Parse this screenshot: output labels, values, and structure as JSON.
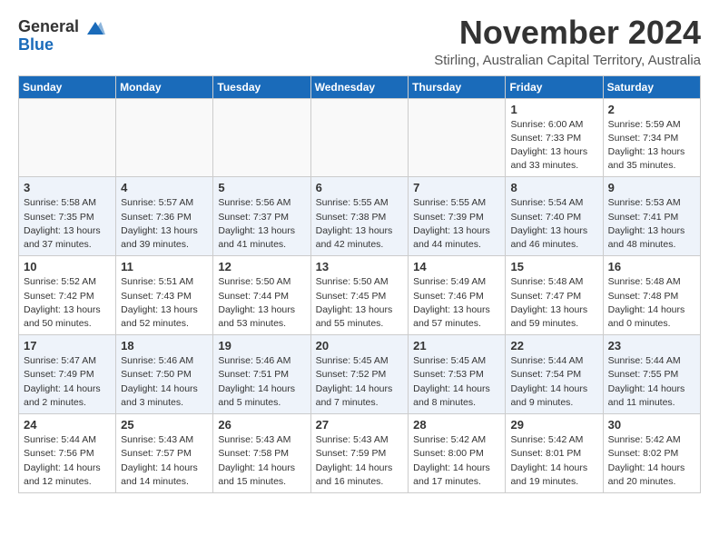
{
  "logo": {
    "general": "General",
    "blue": "Blue"
  },
  "title": "November 2024",
  "subtitle": "Stirling, Australian Capital Territory, Australia",
  "weekdays": [
    "Sunday",
    "Monday",
    "Tuesday",
    "Wednesday",
    "Thursday",
    "Friday",
    "Saturday"
  ],
  "weeks": [
    [
      {
        "day": "",
        "info": ""
      },
      {
        "day": "",
        "info": ""
      },
      {
        "day": "",
        "info": ""
      },
      {
        "day": "",
        "info": ""
      },
      {
        "day": "",
        "info": ""
      },
      {
        "day": "1",
        "info": "Sunrise: 6:00 AM\nSunset: 7:33 PM\nDaylight: 13 hours\nand 33 minutes."
      },
      {
        "day": "2",
        "info": "Sunrise: 5:59 AM\nSunset: 7:34 PM\nDaylight: 13 hours\nand 35 minutes."
      }
    ],
    [
      {
        "day": "3",
        "info": "Sunrise: 5:58 AM\nSunset: 7:35 PM\nDaylight: 13 hours\nand 37 minutes."
      },
      {
        "day": "4",
        "info": "Sunrise: 5:57 AM\nSunset: 7:36 PM\nDaylight: 13 hours\nand 39 minutes."
      },
      {
        "day": "5",
        "info": "Sunrise: 5:56 AM\nSunset: 7:37 PM\nDaylight: 13 hours\nand 41 minutes."
      },
      {
        "day": "6",
        "info": "Sunrise: 5:55 AM\nSunset: 7:38 PM\nDaylight: 13 hours\nand 42 minutes."
      },
      {
        "day": "7",
        "info": "Sunrise: 5:55 AM\nSunset: 7:39 PM\nDaylight: 13 hours\nand 44 minutes."
      },
      {
        "day": "8",
        "info": "Sunrise: 5:54 AM\nSunset: 7:40 PM\nDaylight: 13 hours\nand 46 minutes."
      },
      {
        "day": "9",
        "info": "Sunrise: 5:53 AM\nSunset: 7:41 PM\nDaylight: 13 hours\nand 48 minutes."
      }
    ],
    [
      {
        "day": "10",
        "info": "Sunrise: 5:52 AM\nSunset: 7:42 PM\nDaylight: 13 hours\nand 50 minutes."
      },
      {
        "day": "11",
        "info": "Sunrise: 5:51 AM\nSunset: 7:43 PM\nDaylight: 13 hours\nand 52 minutes."
      },
      {
        "day": "12",
        "info": "Sunrise: 5:50 AM\nSunset: 7:44 PM\nDaylight: 13 hours\nand 53 minutes."
      },
      {
        "day": "13",
        "info": "Sunrise: 5:50 AM\nSunset: 7:45 PM\nDaylight: 13 hours\nand 55 minutes."
      },
      {
        "day": "14",
        "info": "Sunrise: 5:49 AM\nSunset: 7:46 PM\nDaylight: 13 hours\nand 57 minutes."
      },
      {
        "day": "15",
        "info": "Sunrise: 5:48 AM\nSunset: 7:47 PM\nDaylight: 13 hours\nand 59 minutes."
      },
      {
        "day": "16",
        "info": "Sunrise: 5:48 AM\nSunset: 7:48 PM\nDaylight: 14 hours\nand 0 minutes."
      }
    ],
    [
      {
        "day": "17",
        "info": "Sunrise: 5:47 AM\nSunset: 7:49 PM\nDaylight: 14 hours\nand 2 minutes."
      },
      {
        "day": "18",
        "info": "Sunrise: 5:46 AM\nSunset: 7:50 PM\nDaylight: 14 hours\nand 3 minutes."
      },
      {
        "day": "19",
        "info": "Sunrise: 5:46 AM\nSunset: 7:51 PM\nDaylight: 14 hours\nand 5 minutes."
      },
      {
        "day": "20",
        "info": "Sunrise: 5:45 AM\nSunset: 7:52 PM\nDaylight: 14 hours\nand 7 minutes."
      },
      {
        "day": "21",
        "info": "Sunrise: 5:45 AM\nSunset: 7:53 PM\nDaylight: 14 hours\nand 8 minutes."
      },
      {
        "day": "22",
        "info": "Sunrise: 5:44 AM\nSunset: 7:54 PM\nDaylight: 14 hours\nand 9 minutes."
      },
      {
        "day": "23",
        "info": "Sunrise: 5:44 AM\nSunset: 7:55 PM\nDaylight: 14 hours\nand 11 minutes."
      }
    ],
    [
      {
        "day": "24",
        "info": "Sunrise: 5:44 AM\nSunset: 7:56 PM\nDaylight: 14 hours\nand 12 minutes."
      },
      {
        "day": "25",
        "info": "Sunrise: 5:43 AM\nSunset: 7:57 PM\nDaylight: 14 hours\nand 14 minutes."
      },
      {
        "day": "26",
        "info": "Sunrise: 5:43 AM\nSunset: 7:58 PM\nDaylight: 14 hours\nand 15 minutes."
      },
      {
        "day": "27",
        "info": "Sunrise: 5:43 AM\nSunset: 7:59 PM\nDaylight: 14 hours\nand 16 minutes."
      },
      {
        "day": "28",
        "info": "Sunrise: 5:42 AM\nSunset: 8:00 PM\nDaylight: 14 hours\nand 17 minutes."
      },
      {
        "day": "29",
        "info": "Sunrise: 5:42 AM\nSunset: 8:01 PM\nDaylight: 14 hours\nand 19 minutes."
      },
      {
        "day": "30",
        "info": "Sunrise: 5:42 AM\nSunset: 8:02 PM\nDaylight: 14 hours\nand 20 minutes."
      }
    ]
  ]
}
